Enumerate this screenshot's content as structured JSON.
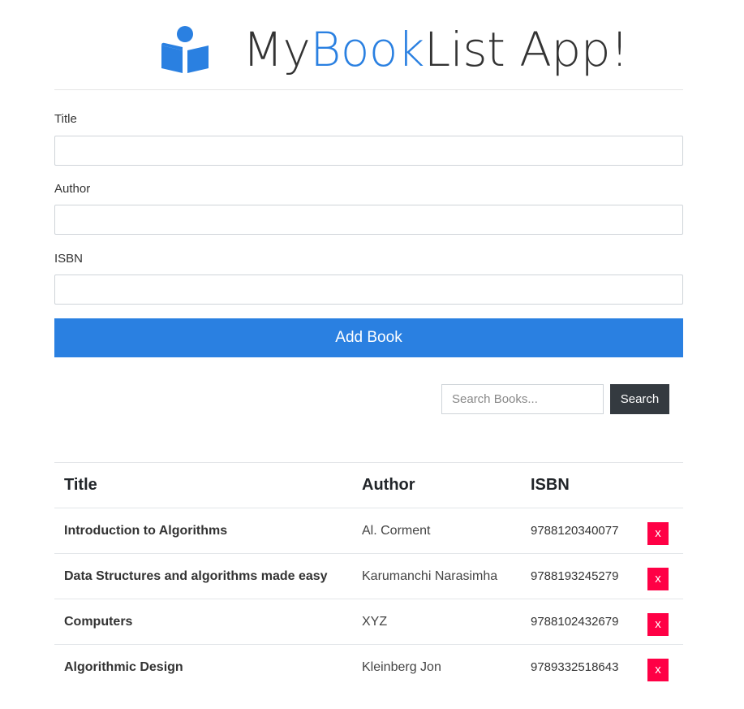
{
  "header": {
    "title_prefix": "My",
    "title_accent": "Book",
    "title_suffix": "List App!",
    "accent_color": "#2a80e1"
  },
  "form": {
    "title_label": "Title",
    "title_value": "",
    "author_label": "Author",
    "author_value": "",
    "isbn_label": "ISBN",
    "isbn_value": "",
    "submit_label": "Add Book"
  },
  "search": {
    "placeholder": "Search Books...",
    "button_label": "Search"
  },
  "table": {
    "columns": [
      "Title",
      "Author",
      "ISBN"
    ],
    "rows": [
      {
        "title": "Introduction to Algorithms",
        "author": "Al. Corment",
        "isbn": "9788120340077",
        "delete_label": "x"
      },
      {
        "title": "Data Structures and algorithms made easy",
        "author": "Karumanchi Narasimha",
        "isbn": "9788193245279",
        "delete_label": "x"
      },
      {
        "title": "Computers",
        "author": "XYZ",
        "isbn": "9788102432679",
        "delete_label": "x"
      },
      {
        "title": "Algorithmic Design",
        "author": "Kleinberg Jon",
        "isbn": "9789332518643",
        "delete_label": "x"
      }
    ]
  }
}
